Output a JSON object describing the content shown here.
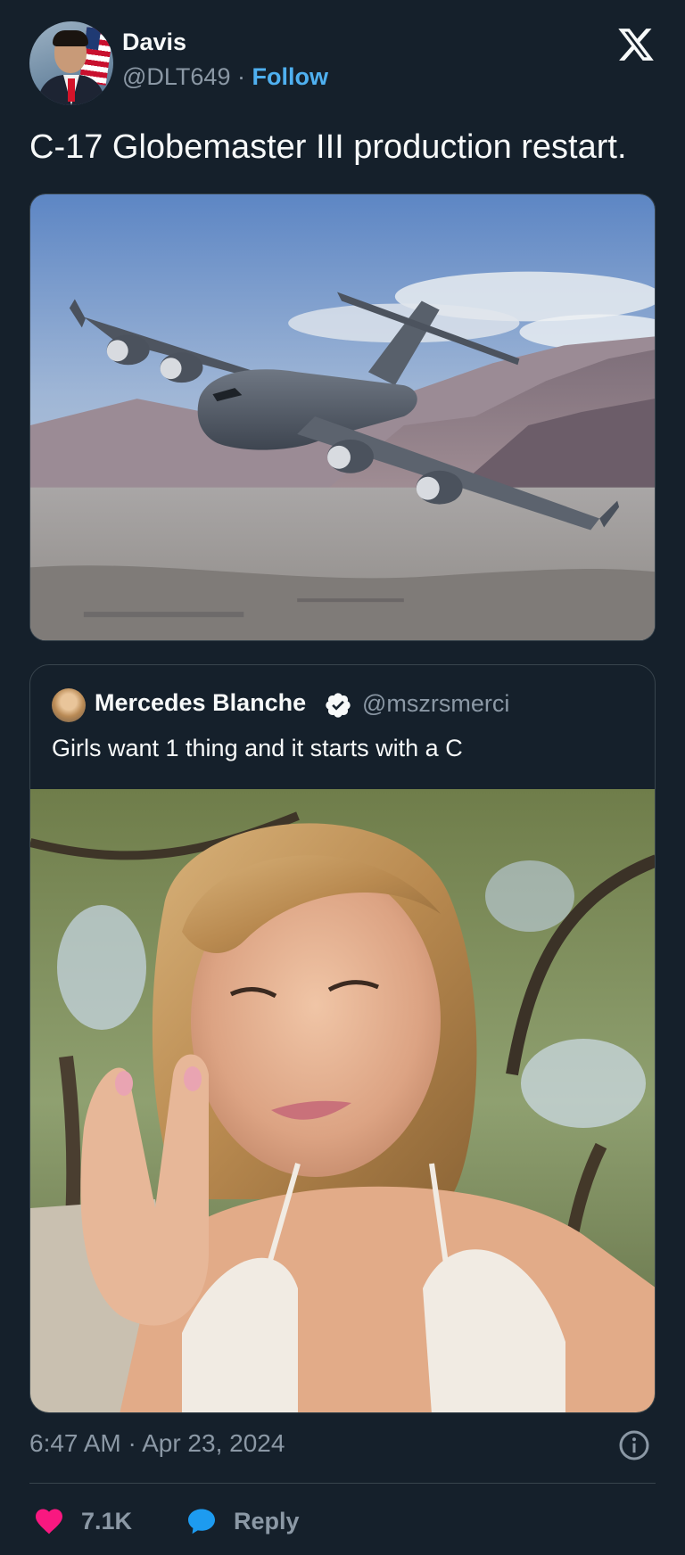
{
  "author": {
    "name": "Davis",
    "handle": "@DLT649",
    "separator": "·",
    "follow_label": "Follow"
  },
  "tweet": {
    "text": "C-17 Globemaster III production restart.",
    "media_icon": "c17-aircraft-photo"
  },
  "quoted_tweet": {
    "author_name": "Mercedes Blanche",
    "author_handle": "@mszrsmerci",
    "verified": true,
    "text": "Girls want 1 thing and it starts with a C",
    "media_icon": "selfie-photo"
  },
  "meta": {
    "timestamp": "6:47 AM · Apr 23, 2024"
  },
  "actions": {
    "likes_count": "7.1K",
    "reply_label": "Reply"
  },
  "colors": {
    "background": "#15202b",
    "text_primary": "#f7f9f9",
    "text_secondary": "#8b98a5",
    "link": "#4fb0f0",
    "like": "#f91880",
    "reply": "#1d9bf0",
    "border": "#38444d"
  },
  "icons": {
    "brand": "x-logo-icon",
    "verified": "verified-badge-icon",
    "info": "info-icon",
    "like": "heart-icon",
    "reply": "speech-bubble-icon"
  }
}
